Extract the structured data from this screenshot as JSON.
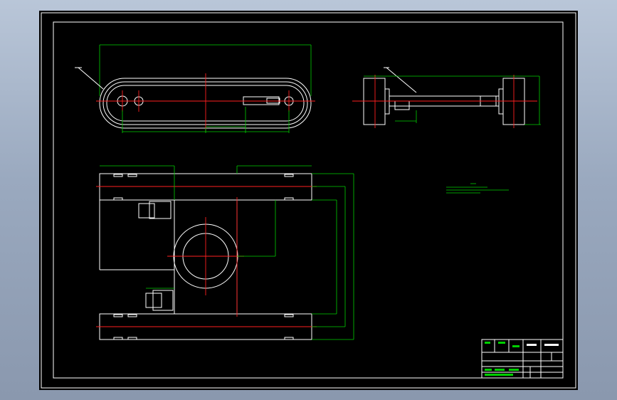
{
  "drawing": {
    "background": "#000000",
    "line_color": "#ffffff",
    "dimension_color": "#00d000",
    "centerline_color": "#ff2020"
  }
}
